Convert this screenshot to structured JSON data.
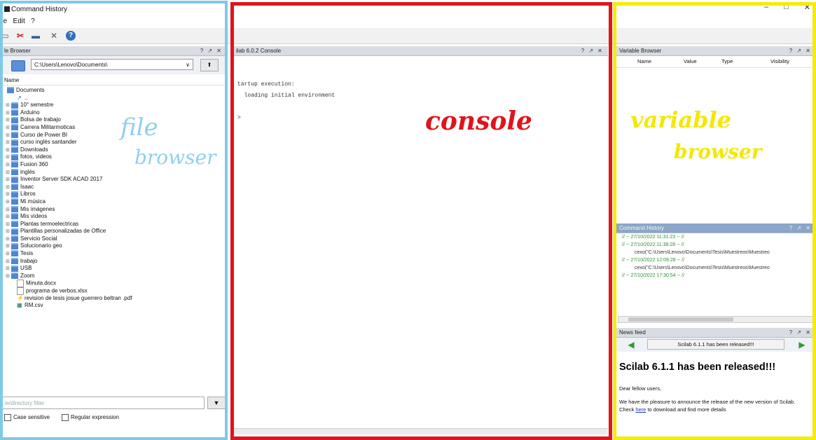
{
  "window": {
    "title": "Command History",
    "controls": [
      "–",
      "□",
      "✕"
    ]
  },
  "menu": [
    "ile",
    "Edit",
    "?"
  ],
  "file_browser": {
    "header": "le Browser",
    "header_controls": "? ↗ ✕",
    "path": "C:\\Users\\Lenovo\\Documents\\",
    "path_arrow": "∨",
    "go_button": "⬆",
    "column": "Name",
    "tree": [
      {
        "label": "Documents",
        "kind": "root",
        "level": 0
      },
      {
        "label": "..",
        "kind": "up",
        "level": 1
      },
      {
        "label": "10° semestre",
        "kind": "folder",
        "level": 1
      },
      {
        "label": "Arduino",
        "kind": "folder",
        "level": 1
      },
      {
        "label": "Bolsa de trabajo",
        "kind": "folder",
        "level": 1
      },
      {
        "label": "Carrera Militarmoticas",
        "kind": "folder",
        "level": 1
      },
      {
        "label": "Curso de Power BI",
        "kind": "folder",
        "level": 1
      },
      {
        "label": "curso inglés santander",
        "kind": "folder",
        "level": 1
      },
      {
        "label": "Downloads",
        "kind": "folder",
        "level": 1
      },
      {
        "label": "fotos, videos",
        "kind": "folder",
        "level": 1
      },
      {
        "label": "Fusion 360",
        "kind": "folder",
        "level": 1
      },
      {
        "label": "inglés",
        "kind": "folder",
        "level": 1
      },
      {
        "label": "Inventor Server SDK ACAD 2017",
        "kind": "folder",
        "level": 1
      },
      {
        "label": "Isaac",
        "kind": "folder",
        "level": 1
      },
      {
        "label": "Libros",
        "kind": "folder",
        "level": 1
      },
      {
        "label": "Mi música",
        "kind": "folder",
        "level": 1
      },
      {
        "label": "Mis imágenes",
        "kind": "folder",
        "level": 1
      },
      {
        "label": "Mis vídeos",
        "kind": "folder",
        "level": 1
      },
      {
        "label": "Plantas termoelectricas",
        "kind": "folder",
        "level": 1
      },
      {
        "label": "Plantillas personalizadas de Office",
        "kind": "folder",
        "level": 1
      },
      {
        "label": "Servicio Social",
        "kind": "folder",
        "level": 1
      },
      {
        "label": "Solucionario geo",
        "kind": "folder",
        "level": 1
      },
      {
        "label": "Tesis",
        "kind": "folder",
        "level": 1
      },
      {
        "label": "trabajo",
        "kind": "folder",
        "level": 1
      },
      {
        "label": "USB",
        "kind": "folder",
        "level": 1
      },
      {
        "label": "Zoom",
        "kind": "folder",
        "level": 1
      },
      {
        "label": "Minuta.docx",
        "kind": "doc",
        "level": 1
      },
      {
        "label": "programa de verbos.xlsx",
        "kind": "doc",
        "level": 1
      },
      {
        "label": "revision de tesis josue guerrero beltran .pdf",
        "kind": "pdf",
        "level": 1
      },
      {
        "label": "RM.csv",
        "kind": "csv",
        "level": 1
      }
    ],
    "filter_placeholder": "le/directory filter",
    "filter_button": "🔽",
    "case_sensitive": "Case sensitive",
    "regular_expression": "Regular expression"
  },
  "console": {
    "header": "ilab 6.0.2 Console",
    "header_controls": "? ↗ ✕",
    "lines": [
      "tartup execution:",
      "  loading initial environment",
      "",
      "",
      ">"
    ]
  },
  "variable_browser": {
    "header": "Variable Browser",
    "header_controls": "? ↗ ✕",
    "columns": [
      "Name",
      "Value",
      "Type",
      "Visibility"
    ]
  },
  "command_history": {
    "header": "Command History",
    "header_controls": "? ↗ ✕",
    "entries": [
      {
        "text": "// -- 27/10/2022 11:31:23 -- //",
        "type": "session"
      },
      {
        "text": "// -- 27/10/2022 11:38:28 -- //",
        "type": "session"
      },
      {
        "text": "cexo(\"C:\\Users\\Lenovo\\Documents\\Tesis\\Muestreos\\Muestreo",
        "type": "command"
      },
      {
        "text": "// -- 27/10/2022 12:09:28 -- //",
        "type": "session"
      },
      {
        "text": "cexo(\"C:\\Users\\Lenovo\\Documents\\Tesis\\Muestreos\\Muestreo",
        "type": "command"
      },
      {
        "text": "// -- 27/10/2022 17:30:54 -- //",
        "type": "session"
      }
    ]
  },
  "news_feed": {
    "header": "News feed",
    "header_controls": "? ↗ ✕",
    "caption": "Scilab 6.1.1 has been released!!!",
    "headline": "Scilab 6.1.1 has been released!!!",
    "greeting": "Dear fellow users,",
    "body_before_link": "We have the pleasure to announce the release of the new version of Scilab. Check ",
    "link": "here",
    "body_after_link": " to download and find more details"
  },
  "overlays": {
    "file_browser_label_1": "file",
    "file_browser_label_2": "browser",
    "console_label": "console",
    "variable_browser_label_1": "variable",
    "variable_browser_label_2": "browser"
  },
  "colors": {
    "file_browser_frame": "#7fc9e6",
    "console_frame": "#e0141c",
    "variable_browser_frame": "#f5ec08",
    "file_browser_text": "#8fd0ec",
    "console_text": "#e0141c",
    "variable_browser_text": "#f3e800"
  }
}
